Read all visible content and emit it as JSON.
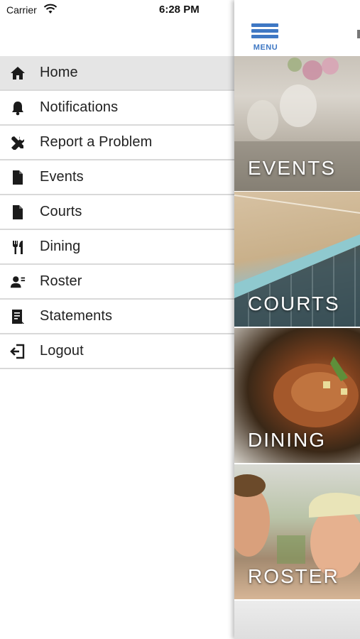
{
  "status_bar": {
    "carrier": "Carrier",
    "time": "6:28 PM"
  },
  "drawer": {
    "items": [
      {
        "label": "Home",
        "icon": "home-icon",
        "active": true
      },
      {
        "label": "Notifications",
        "icon": "bell-icon",
        "active": false
      },
      {
        "label": "Report a Problem",
        "icon": "tools-icon",
        "active": false
      },
      {
        "label": "Events",
        "icon": "document-icon",
        "active": false
      },
      {
        "label": "Courts",
        "icon": "document-icon",
        "active": false
      },
      {
        "label": "Dining",
        "icon": "utensils-icon",
        "active": false
      },
      {
        "label": "Roster",
        "icon": "person-list-icon",
        "active": false
      },
      {
        "label": "Statements",
        "icon": "statement-icon",
        "active": false
      },
      {
        "label": "Logout",
        "icon": "logout-icon",
        "active": false
      }
    ]
  },
  "header": {
    "menu_label": "MENU"
  },
  "tiles": [
    {
      "label": "EVENTS"
    },
    {
      "label": "COURTS"
    },
    {
      "label": "DINING"
    },
    {
      "label": "ROSTER"
    }
  ],
  "colors": {
    "accent": "#3f78c4",
    "active_row": "#e5e5e5",
    "divider": "#d9d9d9"
  }
}
